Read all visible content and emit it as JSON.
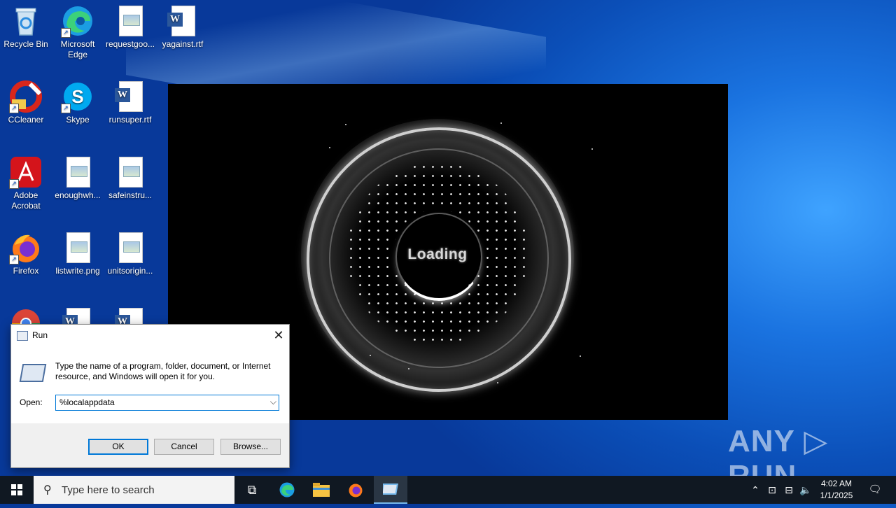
{
  "desktop": {
    "icons": [
      {
        "label": "Recycle Bin",
        "icon": "recycle-bin-icon"
      },
      {
        "label": "Microsoft Edge",
        "icon": "edge-icon"
      },
      {
        "label": "requestgoo...",
        "icon": "image-file-icon"
      },
      {
        "label": "yagainst.rtf",
        "icon": "word-doc-icon"
      },
      {
        "label": "CCleaner",
        "icon": "ccleaner-icon"
      },
      {
        "label": "Skype",
        "icon": "skype-icon"
      },
      {
        "label": "runsuper.rtf",
        "icon": "word-doc-icon"
      },
      {
        "label": "Adobe Acrobat",
        "icon": "acrobat-icon"
      },
      {
        "label": "enoughwh...",
        "icon": "image-file-icon"
      },
      {
        "label": "safeinstru...",
        "icon": "image-file-icon"
      },
      {
        "label": "Firefox",
        "icon": "firefox-icon"
      },
      {
        "label": "listwrite.png",
        "icon": "image-file-icon"
      },
      {
        "label": "unitsorigin...",
        "icon": "image-file-icon"
      }
    ]
  },
  "loading": {
    "text": "Loading"
  },
  "run_dialog": {
    "title": "Run",
    "description": "Type the name of a program, folder, document, or Internet resource, and Windows will open it for you.",
    "open_label": "Open:",
    "open_value": "%localappdata",
    "ok_label": "OK",
    "cancel_label": "Cancel",
    "browse_label": "Browse..."
  },
  "watermark": "ANY ▷ RUN",
  "taskbar": {
    "search_placeholder": "Type here to search",
    "time": "4:02 AM",
    "date": "1/1/2025"
  }
}
